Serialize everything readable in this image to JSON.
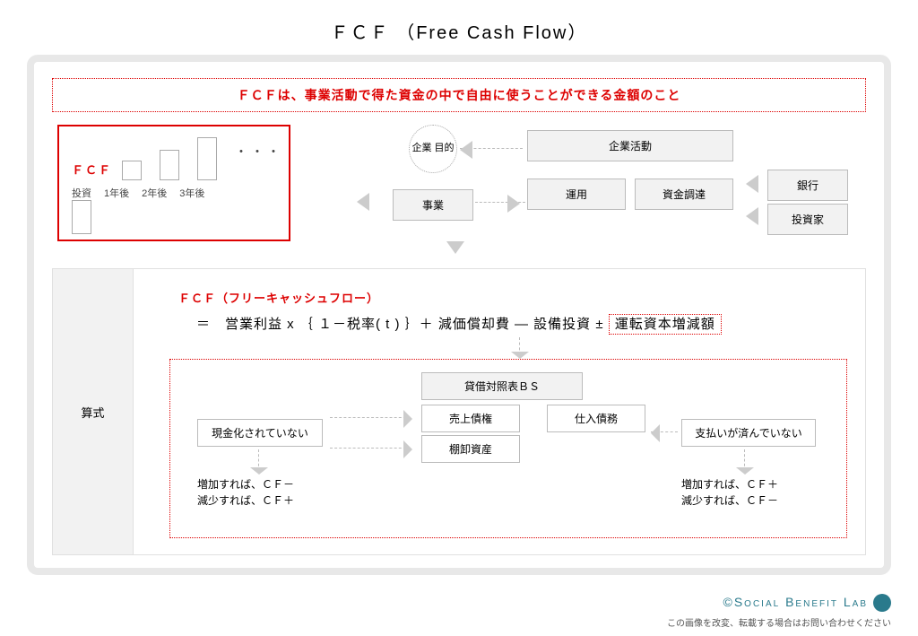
{
  "title": "ＦＣＦ （Free Cash Flow）",
  "banner": "ＦＣＦは、事業活動で得た資金の中で自由に使うことができる金額のこと",
  "fcf": {
    "label": "ＦＣＦ",
    "invest": "投資",
    "y1": "1年後",
    "y2": "2年後",
    "y3": "3年後",
    "dots": "・・・"
  },
  "boxes": {
    "purpose": "企業\n目的",
    "biz": "事業",
    "activity": "企業活動",
    "operate": "運用",
    "fund": "資金調達",
    "bank": "銀行",
    "investor": "投資家"
  },
  "section2": {
    "label": "算式",
    "heading": "ＦＣＦ（フリーキャッシュフロー）",
    "formula_pre": "＝　営業利益  x  ｛ １－税率( t ) ｝＋ 減価償却費 ― 設備投資 ± ",
    "wc": "運転資本増減額"
  },
  "bs": {
    "header": "貸借対照表ＢＳ",
    "cash": "現金化されていない",
    "ar": "売上債権",
    "inv": "棚卸資産",
    "ap": "仕入債務",
    "unpaid": "支払いが済んでいない",
    "note1a": "増加すれば、ＣＦ－",
    "note1b": "減少すれば、ＣＦ＋",
    "note2a": "増加すれば、ＣＦ＋",
    "note2b": "減少すれば、ＣＦ－"
  },
  "footer": {
    "brand": "©Social Benefit Lab",
    "disclaimer": "この画像を改変、転載する場合はお問い合わせください"
  }
}
